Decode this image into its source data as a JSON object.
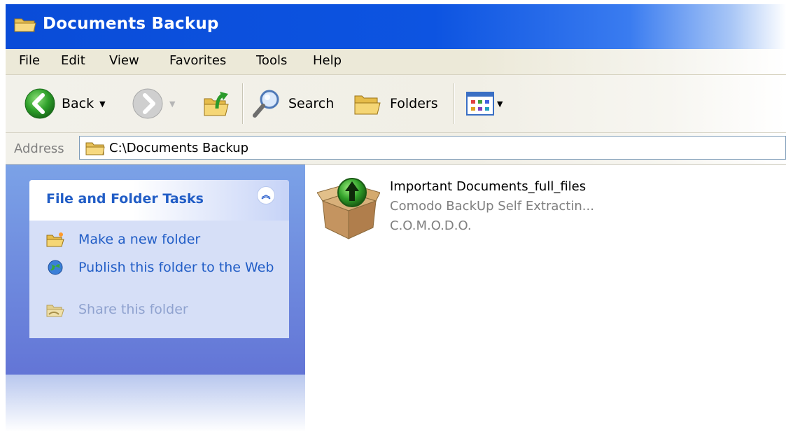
{
  "window": {
    "title": "Documents Backup"
  },
  "menu": [
    "File",
    "Edit",
    "View",
    "Favorites",
    "Tools",
    "Help"
  ],
  "toolbar": {
    "back_label": "Back",
    "search_label": "Search",
    "folders_label": "Folders"
  },
  "address": {
    "label": "Address",
    "value": "C:\\Documents Backup"
  },
  "tasks_panel": {
    "title": "File and Folder Tasks",
    "items": [
      {
        "label": "Make a new folder",
        "icon": "new-folder-icon"
      },
      {
        "label": "Publish this folder to the Web",
        "icon": "globe-icon"
      },
      {
        "label": "Share this folder",
        "icon": "share-folder-icon"
      }
    ]
  },
  "files": [
    {
      "name": "Important Documents_full_files",
      "type": "Comodo BackUp Self Extractin...",
      "company": "C.O.M.O.D.O.",
      "icon": "package-install-icon"
    }
  ],
  "colors": {
    "titlebar_blue": "#0a4cd8",
    "link_blue": "#215dc6",
    "task_panel_bg": "#7ba2e7"
  }
}
